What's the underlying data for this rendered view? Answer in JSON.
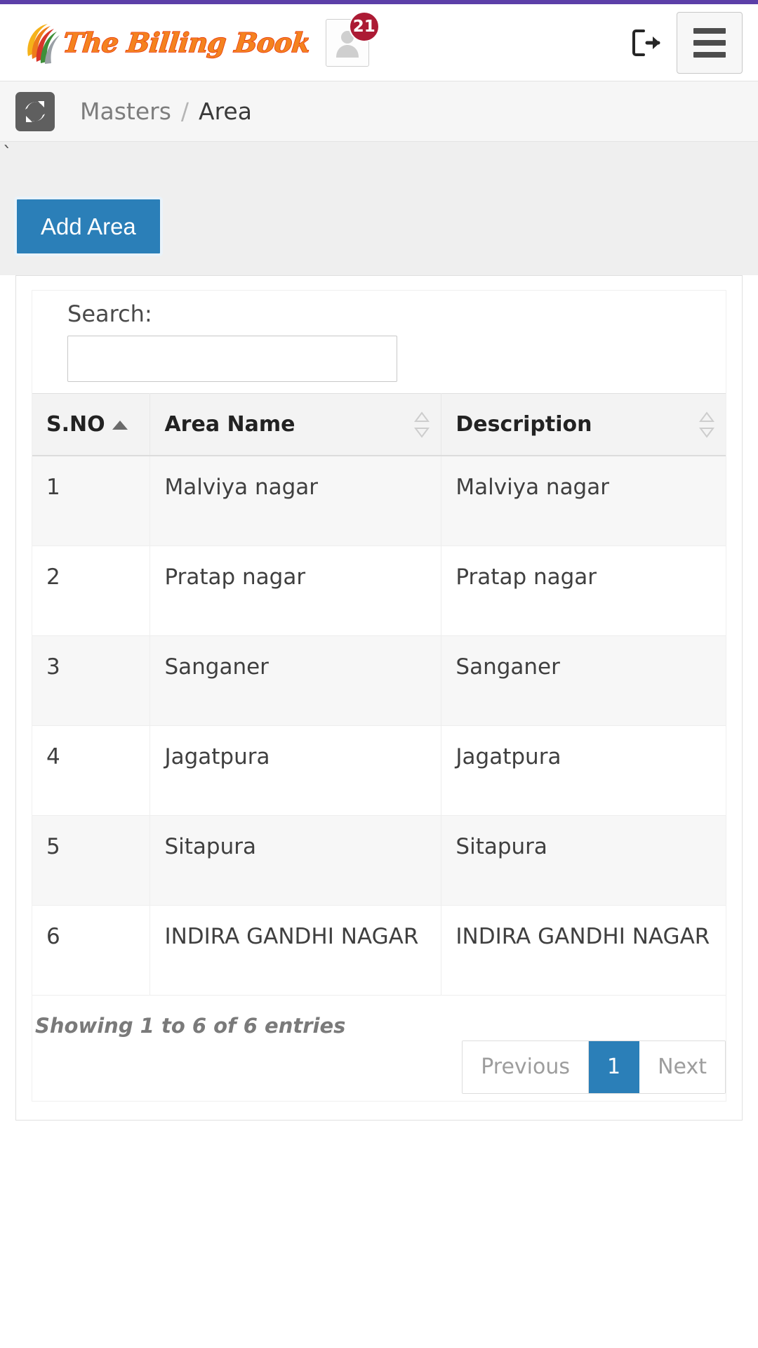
{
  "header": {
    "brand_name": "The Billing Book",
    "brand_color": "#f4821f",
    "brand_stroke_color": "#e8380d",
    "notification_count": "21",
    "notification_badge_color": "#ac1a34",
    "logout_icon": "logout-icon",
    "menu_icon": "hamburger-menu-icon",
    "user_icon": "user-avatar-icon"
  },
  "breadcrumb": {
    "refresh_icon": "refresh-sync-icon",
    "parent": "Masters",
    "separator": "/",
    "current": "Area"
  },
  "page": {
    "stray_text": "`",
    "add_button_label": "Add Area",
    "accent_color": "#2b7fb8"
  },
  "table": {
    "search_label": "Search:",
    "search_value": "",
    "search_placeholder": "",
    "columns": [
      {
        "label": "S.NO",
        "sort": "asc",
        "sort_icon": "sort-ascending-icon"
      },
      {
        "label": "Area Name",
        "sort": "none",
        "sort_icon": "sort-both-icon"
      },
      {
        "label": "Description",
        "sort": "none",
        "sort_icon": "sort-both-icon"
      }
    ],
    "rows": [
      {
        "sno": "1",
        "area_name": "Malviya nagar",
        "description": "Malviya nagar"
      },
      {
        "sno": "2",
        "area_name": "Pratap nagar",
        "description": "Pratap nagar"
      },
      {
        "sno": "3",
        "area_name": "Sanganer",
        "description": "Sanganer"
      },
      {
        "sno": "4",
        "area_name": "Jagatpura",
        "description": "Jagatpura"
      },
      {
        "sno": "5",
        "area_name": "Sitapura",
        "description": "Sitapura"
      },
      {
        "sno": "6",
        "area_name": "INDIRA GANDHI NAGAR",
        "description": "INDIRA GANDHI NAGAR"
      }
    ],
    "showing_info": "Showing 1 to 6 of 6 entries",
    "pagination": {
      "previous_label": "Previous",
      "pages": [
        "1"
      ],
      "active_page": "1",
      "next_label": "Next"
    }
  }
}
